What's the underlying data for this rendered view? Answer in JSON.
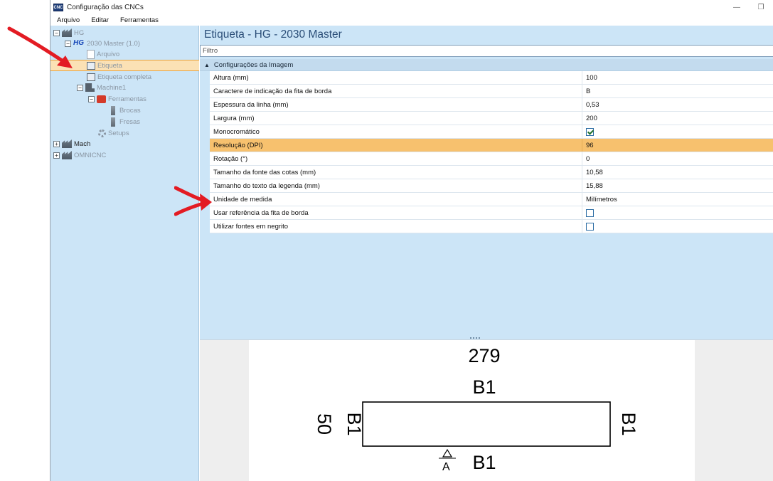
{
  "window": {
    "title": "Configuração das CNCs",
    "app_icon_text": "CNC",
    "minimize_glyph": "—",
    "restore_glyph": "❐"
  },
  "menu": [
    "Arquivo",
    "Editar",
    "Ferramentas"
  ],
  "tree": {
    "hg": "HG",
    "master": "2030 Master (1.0)",
    "arquivo": "Arquivo",
    "etiqueta": "Etiqueta",
    "etiqueta_completa": "Etiqueta completa",
    "machine1": "Machine1",
    "ferramentas": "Ferramentas",
    "brocas": "Brocas",
    "fresas": "Fresas",
    "setups": "Setups",
    "mach": "Mach",
    "omnicnc": "OMNICNC",
    "hg_logo": "HG"
  },
  "panel": {
    "title": "Etiqueta - HG - 2030 Master",
    "filter_placeholder": "Filtro",
    "category": "Configurações da Imagem"
  },
  "properties": [
    {
      "name": "Altura (mm)",
      "value": "100"
    },
    {
      "name": "Caractere de indicação da fita de borda",
      "value": "B"
    },
    {
      "name": "Espessura da linha (mm)",
      "value": "0,53"
    },
    {
      "name": "Largura (mm)",
      "value": "200"
    },
    {
      "name": "Monocromático",
      "value": "",
      "checked": true
    },
    {
      "name": "Resolução (DPI)",
      "value": "96",
      "highlight": true
    },
    {
      "name": "Rotação (°)",
      "value": "0"
    },
    {
      "name": "Tamanho da fonte das cotas (mm)",
      "value": "10,58"
    },
    {
      "name": "Tamanho do texto da legenda (mm)",
      "value": "15,88"
    },
    {
      "name": "Unidade de medida",
      "value": "Milímetros"
    },
    {
      "name": "Usar referência da fita de borda",
      "value": "",
      "checked": false
    },
    {
      "name": "Utilizar fontes em negrito",
      "value": "",
      "checked": false
    }
  ],
  "preview": {
    "width_dim": "279",
    "height_dim": "50",
    "edge_top": "B1",
    "edge_bottom": "B1",
    "edge_left": "B1",
    "edge_right": "B1",
    "marker": "A"
  },
  "colors": {
    "pane_bg": "#cce5f7",
    "selection": "#fbe1b5",
    "row_highlight": "#f7c16e",
    "arrow": "#e31b23"
  }
}
